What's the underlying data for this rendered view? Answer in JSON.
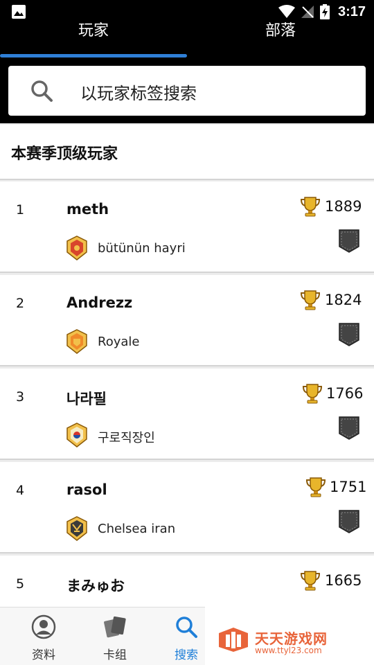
{
  "status_bar": {
    "time": "3:17"
  },
  "tabs": [
    {
      "label": "玩家",
      "active": true
    },
    {
      "label": "部落",
      "active": false
    }
  ],
  "search": {
    "placeholder": "以玩家标签搜索"
  },
  "section": {
    "title": "本赛季顶级玩家"
  },
  "players": [
    {
      "rank": "1",
      "name": "meth",
      "trophies": "1889",
      "clan": "bütünün hayri"
    },
    {
      "rank": "2",
      "name": "Andrezz",
      "trophies": "1824",
      "clan": "Royale"
    },
    {
      "rank": "3",
      "name": "나라필",
      "trophies": "1766",
      "clan": "구로직장인"
    },
    {
      "rank": "4",
      "name": "rasol",
      "trophies": "1751",
      "clan": "Chelsea iran"
    },
    {
      "rank": "5",
      "name": "まみゅお",
      "trophies": "1665",
      "clan": ""
    }
  ],
  "nav": [
    {
      "label": "资料",
      "icon": "profile-icon"
    },
    {
      "label": "卡组",
      "icon": "deck-icon"
    },
    {
      "label": "搜索",
      "icon": "search-icon",
      "active": true
    }
  ],
  "watermark": {
    "title": "天天游戏网",
    "url": "www.ttyl23.com"
  },
  "colors": {
    "accent": "#2f7fd6",
    "active_nav": "#1f7fd8",
    "watermark": "#e8643a"
  }
}
